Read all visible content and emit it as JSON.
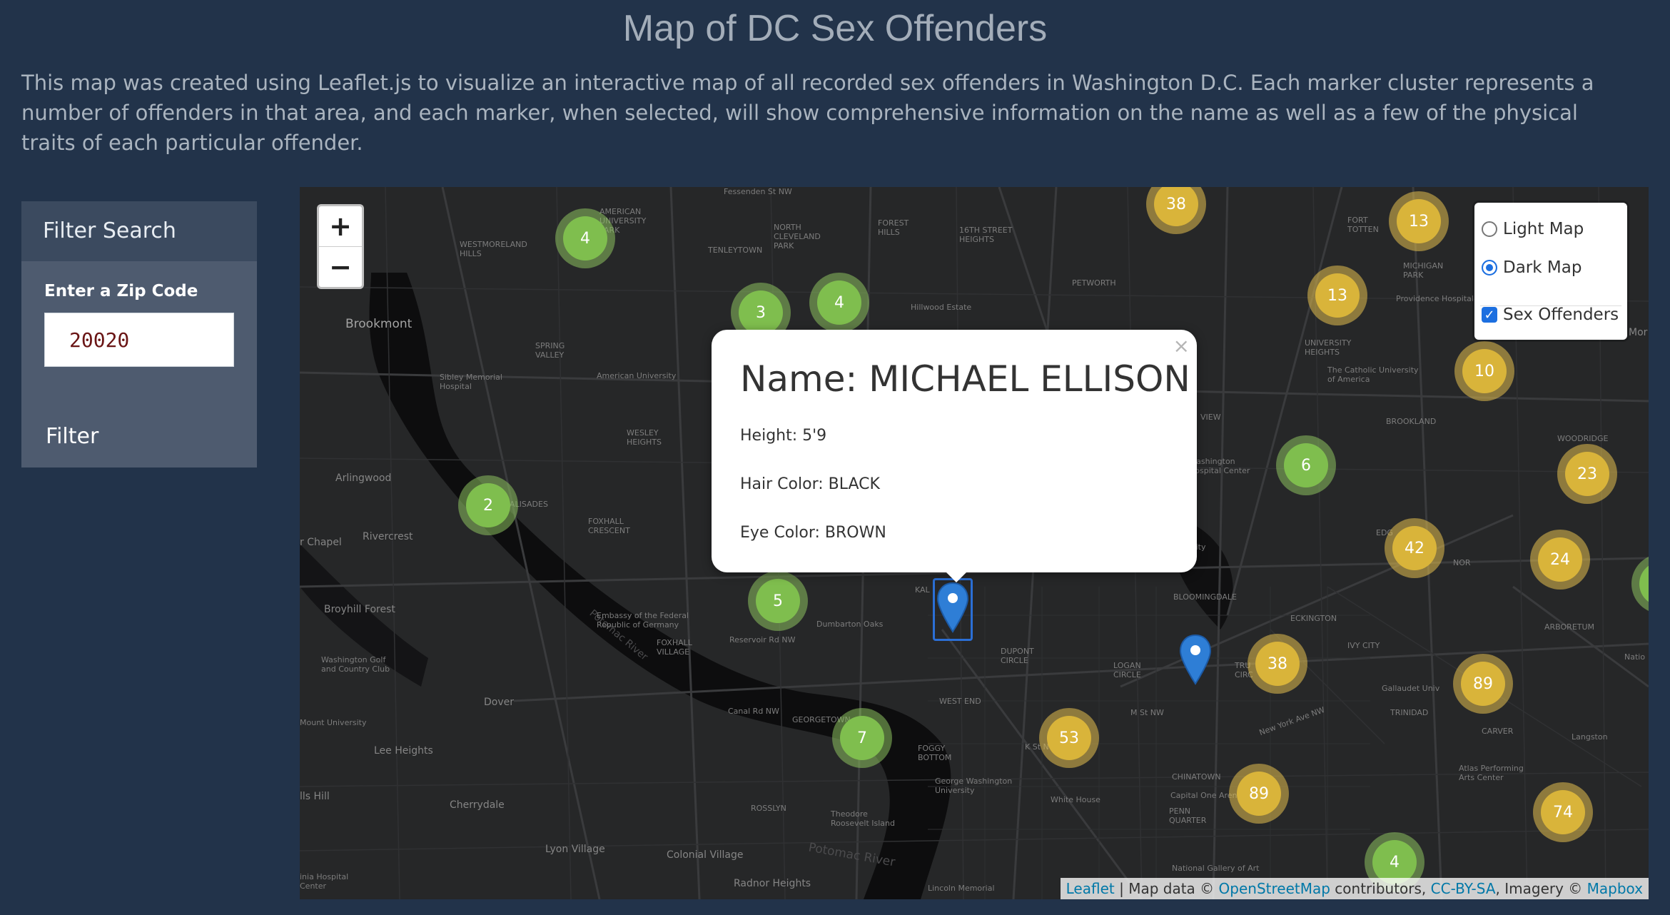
{
  "page": {
    "title": "Map of DC Sex Offenders",
    "intro": "This map was created using Leaflet.js to visualize an interactive map of all recorded sex offenders in Washington D.C. Each marker cluster represents a number of offenders in that area, and each marker, when selected, will show comprehensive information on the name as well as a few of the physical traits of each particular offender."
  },
  "sidebar": {
    "header": "Filter Search",
    "zip_label": "Enter a Zip Code",
    "zip_value": "20020",
    "filter_label": "Filter"
  },
  "map": {
    "zoom_in": "+",
    "zoom_out": "−",
    "layers": {
      "light": "Light Map",
      "dark": "Dark Map",
      "overlay": "Sex Offenders",
      "selected_base": "Dark Map",
      "overlay_checked": true
    },
    "popup": {
      "close": "×",
      "name": "Name: MICHAEL ELLISON",
      "height": "Height: 5'9",
      "hair": "Hair Color: BLACK",
      "eye": "Eye Color: BROWN"
    },
    "clusters": {
      "c1": "4",
      "c2": "3",
      "c3": "4",
      "c4": "2",
      "c5": "5",
      "c6": "7",
      "c7": "38",
      "c8": "13",
      "c9": "13",
      "c10": "10",
      "c11": "6",
      "c12": "23",
      "c13": "42",
      "c14": "24",
      "c15": "38",
      "c16": "89",
      "c17": "53",
      "c18": "89",
      "c19": "74",
      "c20": "4"
    },
    "attribution": {
      "leaflet": "Leaflet",
      "sep1": " | Map data © ",
      "osm": "OpenStreetMap",
      "sep2": " contributors, ",
      "license": "CC-BY-SA",
      "sep3": ", Imagery © ",
      "mapbox": "Mapbox"
    },
    "labels": {
      "brookmont": "Brookmont",
      "arlingwood": "Arlingwood",
      "rivercrest": "Rivercrest",
      "chapel": "r Chapel",
      "broyhill": "Broyhill Forest",
      "dover": "Dover",
      "lee_heights": "Lee Heights",
      "cherrydale": "Cherrydale",
      "lyon_village": "Lyon Village",
      "colonial_village": "Colonial Village",
      "radnor": "Radnor Heights",
      "palisades": "PALISADES",
      "foxhall_crescent": "FOXHALL\nCRESCENT",
      "foxhall_village": "FOXHALL\nVILLAGE",
      "wesley_heights": "WESLEY\nHEIGHTS",
      "spring_valley": "SPRING\nVALLEY",
      "american_univ_park": "AMERICAN\nUNIVERSITY\nPARK",
      "westmoreland": "WESTMORELAND\nHILLS",
      "tenleytown": "TENLEYTOWN",
      "north_cleveland": "NORTH\nCLEVELAND\nPARK",
      "forest_hills": "FOREST\nHILLS",
      "petworth": "PETWORTH",
      "fort_totten": "FORT\nTOTTEN",
      "michigan_park": "MICHIGAN\nPARK",
      "brookland": "BROOKLAND",
      "woodridge": "WOODRIDGE",
      "arboretum": "ARBORETUM",
      "trinidad": "TRINIDAD",
      "carver": "CARVER",
      "dupont": "DUPONT\nCIRCLE",
      "logan": "LOGAN\nCIRCLE",
      "west_end": "WEST END",
      "foggy_bottom": "FOGGY\nBOTTOM",
      "georgetown": "GEORGETOWN",
      "chinatown": "CHINATOWN",
      "penn_quarter": "PENN\nQUARTER",
      "rosslyn": "ROSSLYN",
      "bloomingdale": "BLOOMINGDALE",
      "eckington": "ECKINGTON",
      "ivy_city": "IVY CITY",
      "sixteenth": "16TH STREET\nHEIGHTS",
      "univ_heights": "UNIVERSITY\nHEIGHTS",
      "potomac_river": "Potomac River",
      "potomac_2": "Potomac River",
      "view": "VIEW",
      "edg": "EDG",
      "nor": "NOR",
      "trui": "TRU\nCIRC",
      "kal": "KAL",
      "hillwood": "Hillwood Estate",
      "dumbarton": "Dumbarton Oaks",
      "embassy": "Embassy of the Federal\nRepublic of Germany",
      "american_u": "American University",
      "sibley": "Sibley Memorial\nHospital",
      "wash_golf": "Washington Golf\nand Country Club",
      "catholic_u": "The Catholic University\nof America",
      "wash_hosp": "Washington\nHospital Center",
      "providence": "Providence Hospital",
      "gallaudet": "Gallaudet Univ",
      "gwu": "George Washington\nUniversity",
      "white_house": "White House",
      "capital_one": "Capital One Arena",
      "teddy": "Theodore\nRoosevelt Island",
      "lincoln": "Lincoln Memorial",
      "natl_gallery": "National Gallery of Art",
      "atlas": "Atlas Performing\nArts Center",
      "langston": "Langston",
      "mount_univ": "Mount University",
      "hills_hill": "lls Hill",
      "va_hospital": "inia Hospital\nCenter",
      "university": "University",
      "mor": "Mor",
      "natio": "Natio",
      "fessenden": "Fessenden St NW",
      "reservoir": "Reservoir Rd NW",
      "canal": "Canal Rd NW",
      "new_york_ave": "New York Ave NW",
      "k_st": "K St NW",
      "m_st": "M St NW"
    }
  }
}
